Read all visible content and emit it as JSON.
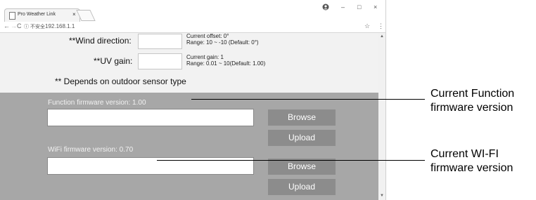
{
  "browser": {
    "tab_title": "Pro Weather Link",
    "tab_close": "×",
    "account_icon": "account-icon",
    "minimize": "–",
    "maximize": "□",
    "close": "×",
    "back": "←",
    "forward": "→",
    "reload": "C",
    "security_text": "ⓘ 不安全",
    "url": "192.168.1.1",
    "bookmark_star": "☆",
    "menu": "⋮"
  },
  "form": {
    "wind_direction_label": "**Wind direction:",
    "wind_note_line1": "Current offset: 0°",
    "wind_note_line2": "Range: 10 ~ -10 (Default: 0°)",
    "uv_gain_label": "**UV gain:",
    "uv_note_line1": "Current gain: 1",
    "uv_note_line2": "Range: 0.01 ~ 10(Default: 1.00)",
    "depends_note": "** Depends on outdoor sensor type"
  },
  "firmware": {
    "function_label": "Function firmware version: 1.00",
    "wifi_label": "WiFi firmware version: 0.70",
    "browse_label": "Browse",
    "upload_label": "Upload"
  },
  "callouts": {
    "function_line1": "Current Function",
    "function_line2": "firmware version",
    "wifi_line1": "Current WI-FI",
    "wifi_line2": "firmware version"
  }
}
